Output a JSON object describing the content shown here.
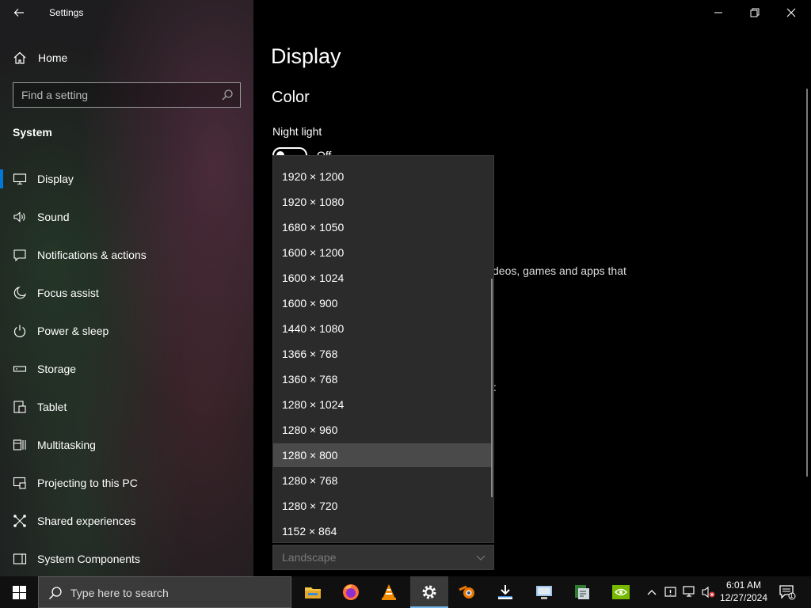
{
  "app": {
    "title": "Settings"
  },
  "sidebar": {
    "home_label": "Home",
    "search_placeholder": "Find a setting",
    "section_title": "System",
    "items": [
      {
        "label": "Display",
        "icon": "monitor-icon",
        "active": true
      },
      {
        "label": "Sound",
        "icon": "speaker-icon"
      },
      {
        "label": "Notifications & actions",
        "icon": "notification-icon"
      },
      {
        "label": "Focus assist",
        "icon": "moon-icon"
      },
      {
        "label": "Power & sleep",
        "icon": "power-icon"
      },
      {
        "label": "Storage",
        "icon": "storage-icon"
      },
      {
        "label": "Tablet",
        "icon": "tablet-icon"
      },
      {
        "label": "Multitasking",
        "icon": "multitasking-icon"
      },
      {
        "label": "Projecting to this PC",
        "icon": "projecting-icon"
      },
      {
        "label": "Shared experiences",
        "icon": "shared-experiences-icon"
      },
      {
        "label": "System Components",
        "icon": "system-components-icon"
      }
    ]
  },
  "main": {
    "page_title": "Display",
    "color_heading": "Color",
    "night_light_label": "Night light",
    "night_light_state": "Off",
    "partial_text_1": "deos, games and apps that",
    "partial_text_2": ":"
  },
  "resolution_dropdown": {
    "options": [
      "1920 × 1200",
      "1920 × 1080",
      "1680 × 1050",
      "1600 × 1200",
      "1600 × 1024",
      "1600 × 900",
      "1440 × 1080",
      "1366 × 768",
      "1360 × 768",
      "1280 × 1024",
      "1280 × 960",
      "1280 × 800",
      "1280 × 768",
      "1280 × 720",
      "1152 × 864"
    ],
    "selected": "1280 × 800"
  },
  "orientation": {
    "value": "Landscape"
  },
  "taskbar": {
    "search_placeholder": "Type here to search",
    "apps": [
      {
        "name": "file-explorer-icon",
        "color": "#f4c542"
      },
      {
        "name": "firefox-icon",
        "color": "#ff7139"
      },
      {
        "name": "vlc-icon",
        "color": "#f08a00"
      },
      {
        "name": "settings-icon",
        "color": "#ffffff",
        "active": true
      },
      {
        "name": "blender-icon",
        "color": "#ea7600"
      },
      {
        "name": "installer-icon",
        "color": "#ffffff"
      },
      {
        "name": "remote-desktop-icon",
        "color": "#9fc4e8"
      },
      {
        "name": "terminal-icon",
        "color": "#2e7d32"
      },
      {
        "name": "nvidia-icon",
        "color": "#76b900"
      }
    ],
    "time": "6:01 AM",
    "date": "12/27/2024",
    "notification_count": "1"
  },
  "colors": {
    "accent": "#0078d7",
    "selected_item": "#4a4a4a",
    "dropdown_bg": "#2b2b2b"
  }
}
